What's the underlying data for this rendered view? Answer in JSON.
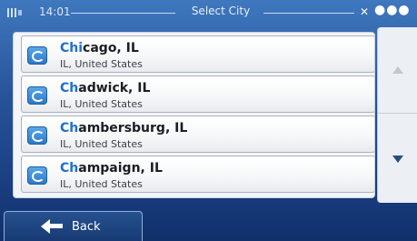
{
  "status_bar": {
    "time": "14:01",
    "title": "Select City",
    "battery_icon": "battery-icon",
    "gps_icon": "gps-signal-icon",
    "menu_icon": "more-dots-icon"
  },
  "list": {
    "items": [
      {
        "highlight": "Chi",
        "rest": "cago, IL",
        "sub": "IL, United States",
        "icon": "city-icon"
      },
      {
        "highlight": "Ch",
        "rest": "adwick, IL",
        "sub": "IL, United States",
        "icon": "city-icon"
      },
      {
        "highlight": "Ch",
        "rest": "ambersburg, IL",
        "sub": "IL, United States",
        "icon": "city-icon"
      },
      {
        "highlight": "Ch",
        "rest": "ampaign, IL",
        "sub": "IL, United States",
        "icon": "city-icon"
      }
    ]
  },
  "scroll": {
    "up_icon": "scroll-up-arrow-icon",
    "down_icon": "scroll-down-arrow-icon"
  },
  "bottom_bar": {
    "back_label": "Back",
    "back_icon": "left-arrow-icon"
  },
  "colors": {
    "background": "#28539a",
    "highlight": "#1f6fce",
    "row_text": "#1a1d22"
  }
}
